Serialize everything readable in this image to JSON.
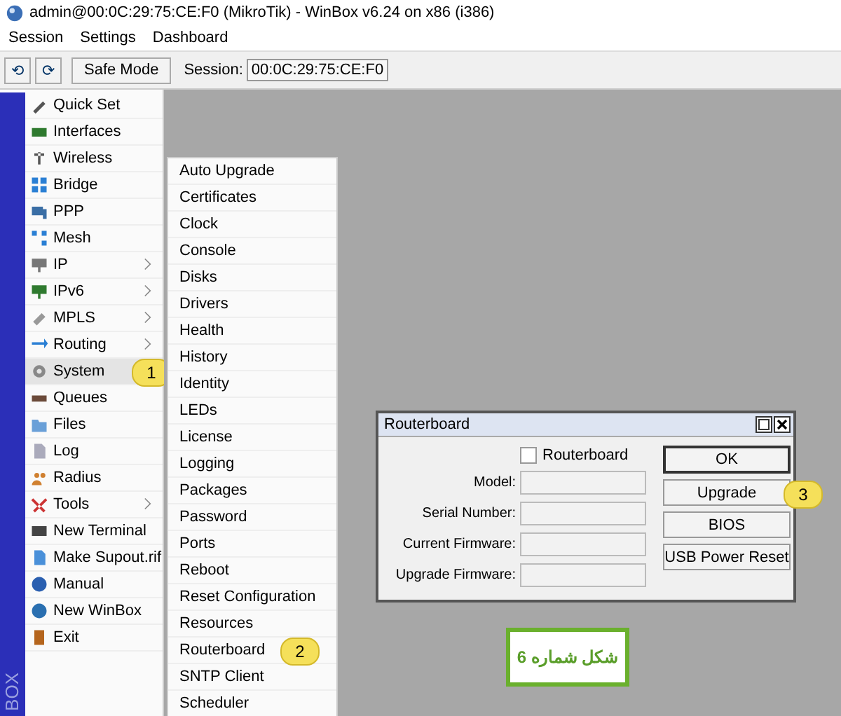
{
  "window": {
    "title": "admin@00:0C:29:75:CE:F0 (MikroTik) - WinBox v6.24 on x86 (i386)"
  },
  "menu_bar": [
    "Session",
    "Settings",
    "Dashboard"
  ],
  "toolbar": {
    "undo": "⟲",
    "redo": "⟳",
    "safe_mode": "Safe Mode",
    "session_label": "Session:",
    "session_value": "00:0C:29:75:CE:F0"
  },
  "side_brand": "BOX",
  "sidebar": {
    "items": [
      {
        "label": "Quick Set",
        "submenu": false,
        "selected": false
      },
      {
        "label": "Interfaces",
        "submenu": false,
        "selected": false
      },
      {
        "label": "Wireless",
        "submenu": false,
        "selected": false
      },
      {
        "label": "Bridge",
        "submenu": false,
        "selected": false
      },
      {
        "label": "PPP",
        "submenu": false,
        "selected": false
      },
      {
        "label": "Mesh",
        "submenu": false,
        "selected": false
      },
      {
        "label": "IP",
        "submenu": true,
        "selected": false
      },
      {
        "label": "IPv6",
        "submenu": true,
        "selected": false
      },
      {
        "label": "MPLS",
        "submenu": true,
        "selected": false
      },
      {
        "label": "Routing",
        "submenu": true,
        "selected": false
      },
      {
        "label": "System",
        "submenu": false,
        "selected": true,
        "callout": "1"
      },
      {
        "label": "Queues",
        "submenu": false,
        "selected": false
      },
      {
        "label": "Files",
        "submenu": false,
        "selected": false
      },
      {
        "label": "Log",
        "submenu": false,
        "selected": false
      },
      {
        "label": "Radius",
        "submenu": false,
        "selected": false
      },
      {
        "label": "Tools",
        "submenu": true,
        "selected": false
      },
      {
        "label": "New Terminal",
        "submenu": false,
        "selected": false
      },
      {
        "label": "Make Supout.rif",
        "submenu": false,
        "selected": false
      },
      {
        "label": "Manual",
        "submenu": false,
        "selected": false
      },
      {
        "label": "New WinBox",
        "submenu": false,
        "selected": false
      },
      {
        "label": "Exit",
        "submenu": false,
        "selected": false
      }
    ]
  },
  "submenu": {
    "items": [
      {
        "label": "Auto Upgrade"
      },
      {
        "label": "Certificates"
      },
      {
        "label": "Clock"
      },
      {
        "label": "Console"
      },
      {
        "label": "Disks"
      },
      {
        "label": "Drivers"
      },
      {
        "label": "Health"
      },
      {
        "label": "History"
      },
      {
        "label": "Identity"
      },
      {
        "label": "LEDs"
      },
      {
        "label": "License"
      },
      {
        "label": "Logging"
      },
      {
        "label": "Packages"
      },
      {
        "label": "Password"
      },
      {
        "label": "Ports"
      },
      {
        "label": "Reboot"
      },
      {
        "label": "Reset Configuration"
      },
      {
        "label": "Resources"
      },
      {
        "label": "Routerboard",
        "callout": "2"
      },
      {
        "label": "SNTP Client"
      },
      {
        "label": "Scheduler"
      }
    ]
  },
  "dialog": {
    "title": "Routerboard",
    "checkbox": {
      "label": "Routerboard",
      "checked": false
    },
    "fields": [
      {
        "label": "Model:"
      },
      {
        "label": "Serial Number:"
      },
      {
        "label": "Current Firmware:"
      },
      {
        "label": "Upgrade Firmware:"
      }
    ],
    "buttons": [
      {
        "label": "OK",
        "kind": "default"
      },
      {
        "label": "Upgrade",
        "kind": "normal",
        "callout": "3"
      },
      {
        "label": "BIOS",
        "kind": "normal"
      },
      {
        "label": "USB Power Reset",
        "kind": "normal"
      }
    ]
  },
  "caption": "شکل شماره 6"
}
